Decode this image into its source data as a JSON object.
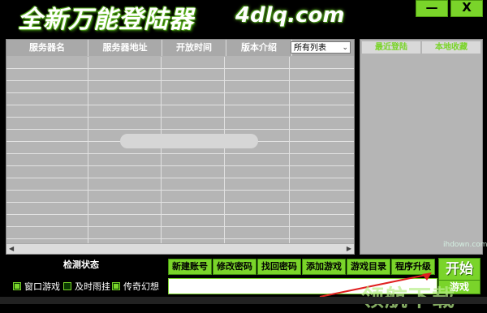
{
  "header": {
    "logo_text": "全新万能登陆器",
    "logo_url": "4dlq.com",
    "minimize_label": "—",
    "close_label": "X"
  },
  "server_list": {
    "columns": [
      "服务器名",
      "服务器地址",
      "开放时间",
      "版本介绍"
    ],
    "filter_selected": "所有列表",
    "row_count": 16
  },
  "side_panel": {
    "tabs": [
      "最近登陆",
      "本地收藏"
    ]
  },
  "status": {
    "label": "检测状态"
  },
  "options": [
    {
      "label": "窗口游戏",
      "checked": true
    },
    {
      "label": "及时雨挂",
      "checked": false
    },
    {
      "label": "传奇幻想",
      "checked": true
    }
  ],
  "actions": [
    "新建账号",
    "修改密码",
    "找回密码",
    "添加游戏",
    "游戏目录",
    "程序升级"
  ],
  "start_button": {
    "label": "开始",
    "secondary_label": "游戏"
  },
  "watermark": {
    "site": "ihdown.com",
    "text": "领航下载"
  },
  "colors": {
    "accent": "#7ad42a",
    "background": "#000000",
    "panel": "#b5b5b5"
  }
}
